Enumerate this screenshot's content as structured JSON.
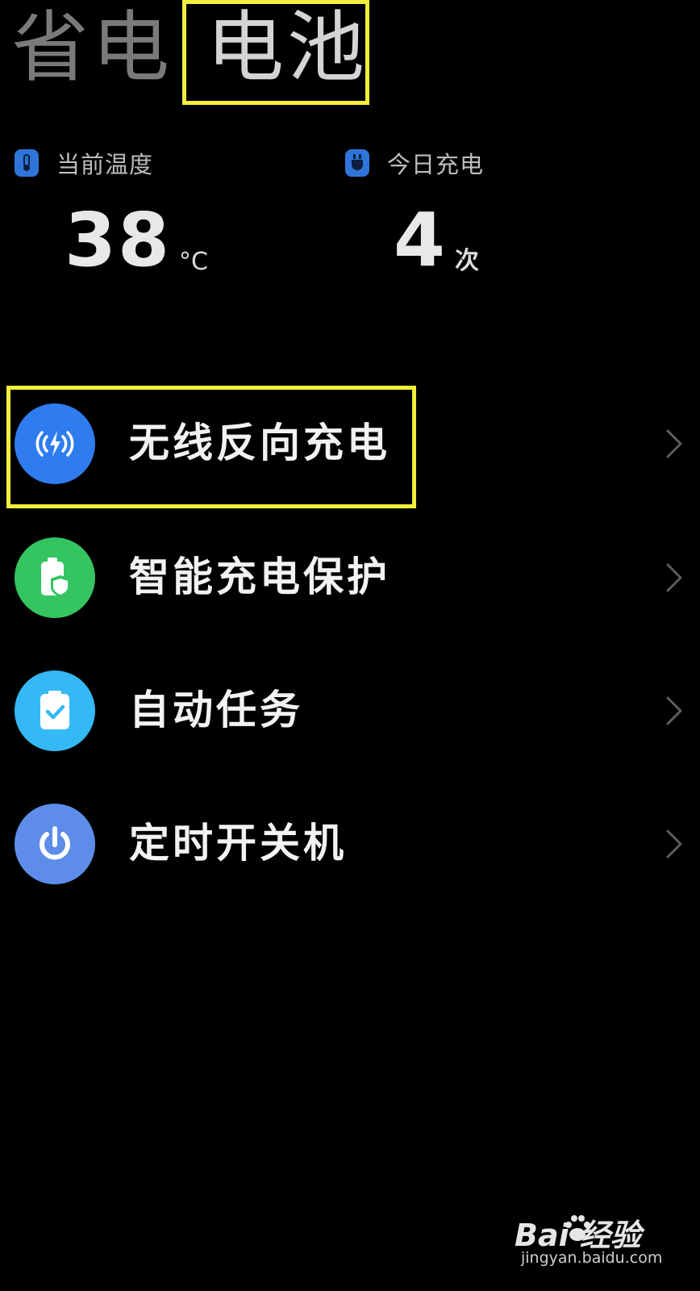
{
  "tabs": [
    {
      "label": "省电",
      "active": false
    },
    {
      "label": "电池",
      "active": true
    }
  ],
  "stats": {
    "temperature": {
      "label": "当前温度",
      "value": "38",
      "unit": "°C",
      "icon": "thermometer-icon"
    },
    "charges": {
      "label": "今日充电",
      "value": "4",
      "unit": "次",
      "icon": "plug-icon"
    }
  },
  "menu": [
    {
      "label": "无线反向充电",
      "icon": "wireless-charge-icon",
      "color": "#2f7cf0"
    },
    {
      "label": "智能充电保护",
      "icon": "battery-shield-icon",
      "color": "#34c460"
    },
    {
      "label": "自动任务",
      "icon": "clipboard-check-icon",
      "color": "#35b9f5"
    },
    {
      "label": "定时开关机",
      "icon": "power-icon",
      "color": "#5d8de8"
    }
  ],
  "highlight_color": "#f2ee3c",
  "watermark": {
    "logo_text": "Bai  经验",
    "url": "jingyan.baidu.com"
  }
}
